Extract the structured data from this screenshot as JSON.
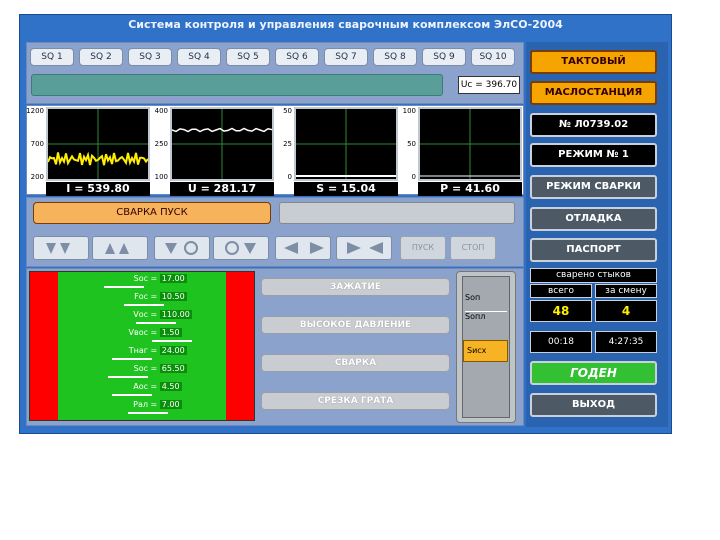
{
  "window": {
    "title": "Система контроля и управления сварочным комплексом ЭлСО-2004"
  },
  "sq_buttons": [
    "SQ 1",
    "SQ 2",
    "SQ 3",
    "SQ 4",
    "SQ 5",
    "SQ 6",
    "SQ 7",
    "SQ 8",
    "SQ 9",
    "SQ 10"
  ],
  "readout_top": "Uc = 396.70",
  "scopes": [
    {
      "yticks": [
        "1200",
        "700",
        "200"
      ],
      "label": "I = 539.80"
    },
    {
      "yticks": [
        "400",
        "250",
        "100"
      ],
      "label": "U = 281.17"
    },
    {
      "yticks": [
        "50",
        "25",
        "0"
      ],
      "label": "S = 15.04"
    },
    {
      "yticks": [
        "100",
        "50",
        "0"
      ],
      "label": "P = 41.60"
    }
  ],
  "svarka_pusk": "СВАРКА ПУСК",
  "control_buttons": {
    "pusk": "ПУСК",
    "stop": "СТОП"
  },
  "sidebar": {
    "taktovy": "ТАКТОВЫЙ",
    "maslostantsiya": "МАСЛОСТАНЦИЯ",
    "number": "№ Л0739.02",
    "rezhim": "РЕЖИМ № 1",
    "rezhim_svarki": "РЕЖИМ СВАРКИ",
    "otladka": "ОТЛАДКА",
    "pasport": "ПАСПОРТ",
    "godna": "ГОДЕН",
    "exit": "ВЫХОД"
  },
  "counters": {
    "title": "сварено стыков",
    "total_label": "всего",
    "shift_label": "за смену",
    "total_value": "48",
    "shift_value": "4",
    "time_left": "00:18",
    "time_right": "4:27:35"
  },
  "params": [
    {
      "label": "Sос",
      "value": "17.00",
      "level": 0.3
    },
    {
      "label": "Fос",
      "value": "10.50",
      "level": 0.55
    },
    {
      "label": "Vос",
      "value": "110.00",
      "level": 0.7
    },
    {
      "label": "Vвос",
      "value": "1.50",
      "level": 0.9
    },
    {
      "label": "Tнаг",
      "value": "24.00",
      "level": 0.4
    },
    {
      "label": "Sос",
      "value": "65.50",
      "level": 0.35
    },
    {
      "label": "Aос",
      "value": "4.50",
      "level": 0.4
    },
    {
      "label": "Pал",
      "value": "7.00",
      "level": 0.6
    }
  ],
  "operations": [
    "ЗАЖАТИЕ",
    "ВЫСОКОЕ ДАВЛЕНИЕ",
    "СВАРКА",
    "СРЕЗКА ГРАТА"
  ],
  "gauge_labels": [
    "Sоп",
    "Sопл",
    "Sисх"
  ],
  "colors": {
    "window": "#2f72c7",
    "accent": "#f6a500",
    "ok": "#33c133"
  }
}
